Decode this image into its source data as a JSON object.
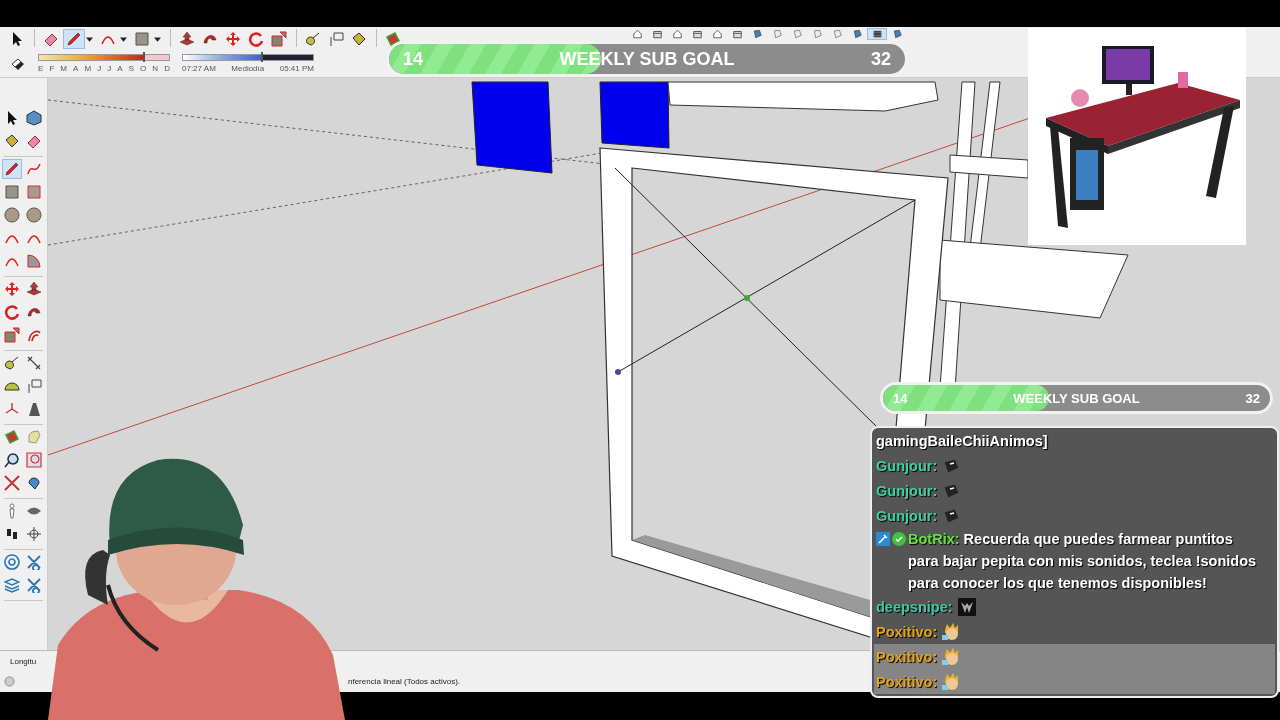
{
  "toolbar": {
    "tools": [
      {
        "selected": false
      },
      {
        "selected": false
      },
      {
        "selected": true
      },
      {
        "selected": false
      },
      {
        "selected": false
      },
      {
        "selected": false
      },
      {
        "selected": false
      },
      {
        "selected": false
      },
      {
        "selected": false
      },
      {
        "selected": false
      },
      {
        "selected": false
      },
      {
        "selected": false
      },
      {
        "selected": false
      },
      {
        "selected": false
      }
    ],
    "extra_tools": [
      {
        "selected": false
      },
      {
        "selected": false
      },
      {
        "selected": false
      },
      {
        "selected": false
      },
      {
        "selected": false
      },
      {
        "selected": false
      },
      {
        "selected": false
      },
      {
        "selected": false
      },
      {
        "selected": false
      },
      {
        "selected": false
      },
      {
        "selected": false
      },
      {
        "selected": false
      },
      {
        "selected": true
      },
      {
        "selected": false
      }
    ],
    "date_slider": {
      "months": [
        "E",
        "F",
        "M",
        "A",
        "M",
        "J",
        "J",
        "A",
        "S",
        "O",
        "N",
        "D"
      ],
      "level": 0.8
    },
    "time_slider": {
      "start": "07:27 AM",
      "middle": "Mediodía",
      "end": "05:41 PM",
      "level": 0.6
    }
  },
  "left_toolbar": {
    "groups": [
      [
        {
          "selected": false
        },
        {
          "selected": false
        },
        {
          "selected": false
        },
        {
          "selected": false
        }
      ],
      [
        {
          "selected": true
        },
        {
          "selected": false
        },
        {
          "selected": false
        },
        {
          "selected": false
        },
        {
          "selected": false
        },
        {
          "selected": false
        },
        {
          "selected": false
        },
        {
          "selected": false
        },
        {
          "selected": false
        },
        {
          "selected": false
        }
      ],
      [
        {
          "selected": false
        },
        {
          "selected": false
        },
        {
          "selected": false
        },
        {
          "selected": false
        },
        {
          "selected": false
        },
        {
          "selected": false
        }
      ],
      [
        {
          "selected": false
        },
        {
          "selected": false
        },
        {
          "selected": false
        },
        {
          "selected": false
        },
        {
          "selected": false
        },
        {
          "selected": false
        }
      ],
      [
        {
          "selected": false
        },
        {
          "selected": false
        },
        {
          "selected": false
        },
        {
          "selected": false
        },
        {
          "selected": false
        },
        {
          "selected": false
        }
      ],
      [
        {
          "selected": false
        },
        {
          "selected": false
        },
        {
          "selected": false
        },
        {
          "selected": false
        }
      ],
      [
        {
          "selected": false
        },
        {
          "selected": false
        },
        {
          "selected": false
        },
        {
          "selected": false
        }
      ]
    ]
  },
  "goal_overlay": {
    "current": "14",
    "title": "WEEKLY SUB GOAL",
    "target": "32",
    "level": 0.41
  },
  "chat_goal": {
    "current": "14",
    "title": "WEEKLY SUB GOAL",
    "target": "32",
    "level": 0.43
  },
  "chat": {
    "messages": [
      {
        "kind": "text",
        "text": "gamingBaileChiiAnimos]",
        "highlighted": false
      },
      {
        "kind": "key",
        "name": "Gunjour:",
        "color": "#3ecfa0",
        "highlighted": false
      },
      {
        "kind": "key",
        "name": "Gunjour:",
        "color": "#3ecfa0",
        "highlighted": false
      },
      {
        "kind": "key",
        "name": "Gunjour:",
        "color": "#3ecfa0",
        "highlighted": false
      },
      {
        "kind": "bot",
        "name": "BotRix:",
        "color": "#63e23f",
        "text": "Recuerda que puedes farmear puntitos para bajar pepita con mis sonidos, teclea !sonidos para conocer los que tenemos disponibles!",
        "highlighted": false
      },
      {
        "kind": "mask",
        "name": "deepsnipe:",
        "color": "#3ec9a6",
        "highlighted": false
      },
      {
        "kind": "face",
        "name": "Poxitivo:",
        "color": "#e3a21a",
        "highlighted": false
      },
      {
        "kind": "face",
        "name": "Poxitivo:",
        "color": "#e3a21a",
        "highlighted": true
      },
      {
        "kind": "face",
        "name": "Poxitivo:",
        "color": "#e3a21a",
        "highlighted": true
      }
    ]
  },
  "status_bar": {
    "label": "Longitu",
    "hint": "nferencia lineal (Todos activos)."
  }
}
